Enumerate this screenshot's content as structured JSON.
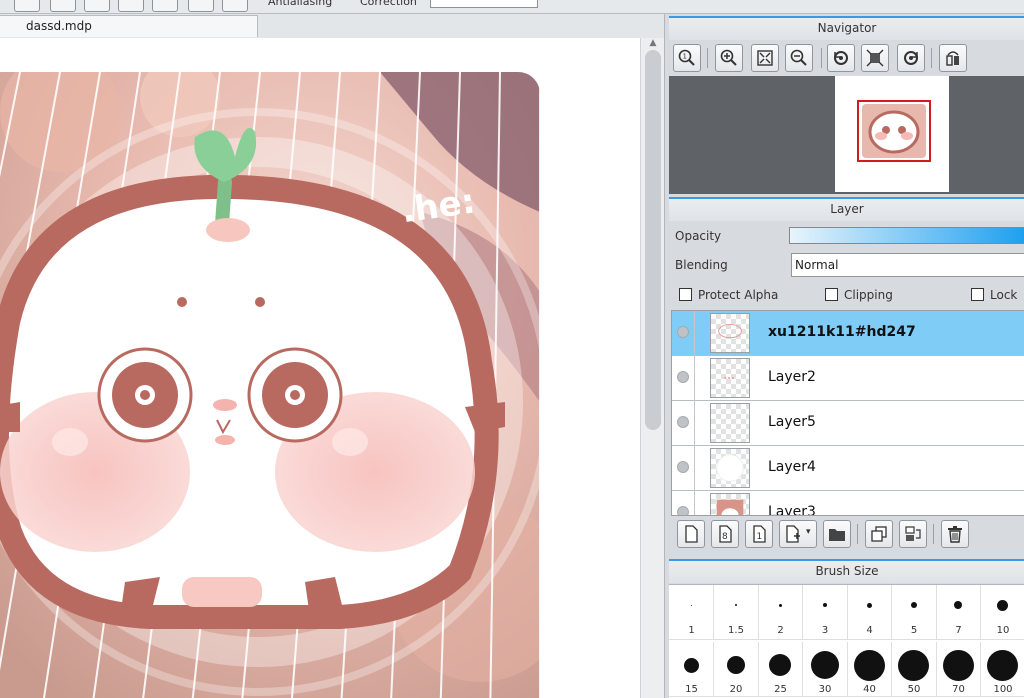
{
  "document": {
    "tab_title": "dassd.mdp"
  },
  "toolbar": {
    "antialiasing_label": "Antialiasing",
    "correction_label": "Correction"
  },
  "navigator": {
    "title": "Navigator"
  },
  "layer_panel": {
    "title": "Layer",
    "opacity_label": "Opacity",
    "blending_label": "Blending",
    "blending_value": "Normal",
    "protect_alpha_label": "Protect Alpha",
    "clipping_label": "Clipping",
    "lock_label": "Lock",
    "layers": [
      {
        "name": "xu1211k11#hd247",
        "selected": true
      },
      {
        "name": "Layer2",
        "selected": false
      },
      {
        "name": "Layer5",
        "selected": false
      },
      {
        "name": "Layer4",
        "selected": false
      },
      {
        "name": "Layer3",
        "selected": false
      }
    ]
  },
  "brush_panel": {
    "title": "Brush Size",
    "sizes": [
      "1",
      "1.5",
      "2",
      "3",
      "4",
      "5",
      "7",
      "10",
      "15",
      "20",
      "25",
      "30",
      "40",
      "50",
      "70",
      "100"
    ]
  },
  "artwork": {
    "text": ".he:"
  },
  "colors": {
    "accent": "#3b9ae8",
    "selected_layer": "#7fcdf6",
    "nav_frame": "#d21c1c",
    "brown": "#b86a60"
  }
}
